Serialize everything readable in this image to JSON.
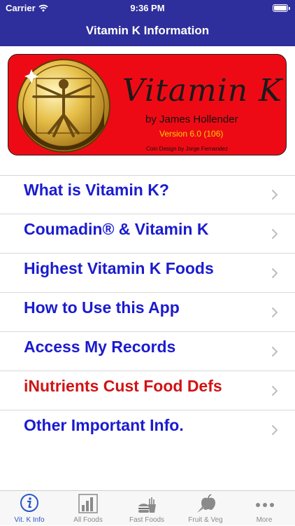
{
  "status_bar": {
    "carrier": "Carrier",
    "time": "9:36 PM"
  },
  "nav": {
    "title": "Vitamin K Information"
  },
  "banner": {
    "title": "Vitamin K",
    "author": "by James Hollender",
    "version": "Version 6.0 (106)",
    "coin_credit": "Coin Design by Jorge Fernandez"
  },
  "menu": {
    "items": [
      {
        "label": "What is Vitamin K?",
        "color": "#1b1bd0"
      },
      {
        "label": "Coumadin® & Vitamin K",
        "color": "#1b1bd0"
      },
      {
        "label": "Highest Vitamin K Foods",
        "color": "#1b1bd0"
      },
      {
        "label": "How to Use this App",
        "color": "#1b1bd0"
      },
      {
        "label": "Access My Records",
        "color": "#1b1bd0"
      },
      {
        "label": "iNutrients Cust Food Defs",
        "color": "#d01414"
      },
      {
        "label": "Other Important Info.",
        "color": "#1b1bd0"
      }
    ]
  },
  "tabs": [
    {
      "label": "Vit. K Info",
      "icon": "info-icon",
      "active": true
    },
    {
      "label": "All Foods",
      "icon": "bar-chart-icon",
      "active": false
    },
    {
      "label": "Fast Foods",
      "icon": "burger-fries-icon",
      "active": false
    },
    {
      "label": "Fruit & Veg",
      "icon": "apple-carrot-icon",
      "active": false
    },
    {
      "label": "More",
      "icon": "more-dots-icon",
      "active": false
    }
  ],
  "colors": {
    "nav_bar": "#2e2e9c",
    "banner_red": "#ee0a14",
    "menu_blue": "#1b1bd0",
    "menu_red": "#d01414",
    "tab_active": "#2b56c8"
  }
}
